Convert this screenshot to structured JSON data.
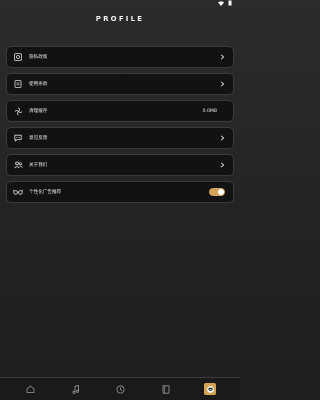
{
  "header": {
    "title": "PROFILE"
  },
  "menu": [
    {
      "label": "隐私政策",
      "icon": "privacy-icon"
    },
    {
      "label": "使用条款",
      "icon": "document-icon"
    },
    {
      "label": "清理缓存",
      "icon": "clear-cache-icon",
      "value": "0.0MB"
    },
    {
      "label": "意见反馈",
      "icon": "feedback-icon"
    },
    {
      "label": "关于我们",
      "icon": "about-icon"
    },
    {
      "label": "个性化广告推荐",
      "icon": "glasses-icon",
      "toggle_on": true
    }
  ],
  "tabbar": {
    "tabs": [
      "home-icon",
      "music-icon",
      "clock-icon",
      "book-icon",
      "profile-icon"
    ],
    "active": "profile-icon"
  },
  "colors": {
    "accent": "#d4a253",
    "card": "#121212",
    "border": "#3a3a3a"
  }
}
